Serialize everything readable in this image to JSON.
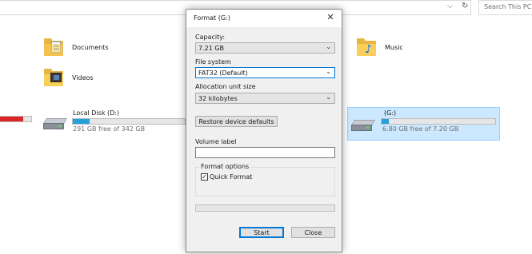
{
  "explorer": {
    "search_placeholder": "Search This PC",
    "folders": [
      {
        "label": "Documents"
      },
      {
        "label": "Music"
      },
      {
        "label": "Videos"
      }
    ],
    "drives": [
      {
        "name": "Local Disk (D:)",
        "free_text": "291 GB free of 342 GB",
        "used_fraction": 0.15
      },
      {
        "name": "(G:)",
        "free_text": "6.80 GB free of 7.20 GB",
        "used_fraction": 0.06
      }
    ],
    "partial_drive_used_fraction": 0.75
  },
  "dialog": {
    "title": "Format  (G:)",
    "close_glyph": "✕",
    "capacity_label": "Capacity:",
    "capacity_value": "7.21 GB",
    "filesystem_label": "File system",
    "filesystem_value": "FAT32 (Default)",
    "allocation_label": "Allocation unit size",
    "allocation_value": "32 kilobytes",
    "restore_button": "Restore device defaults",
    "volume_label": "Volume label",
    "volume_value": "",
    "format_options_label": "Format options",
    "quick_format_label": "Quick Format",
    "quick_format_checked": "✓",
    "progress_fraction": 0,
    "start_button": "Start",
    "close_button": "Close"
  },
  "colors": {
    "accent": "#0078d7",
    "drive_bar": "#26a0da",
    "drive_bar_full": "#da2626",
    "selection": "#cce8ff"
  }
}
